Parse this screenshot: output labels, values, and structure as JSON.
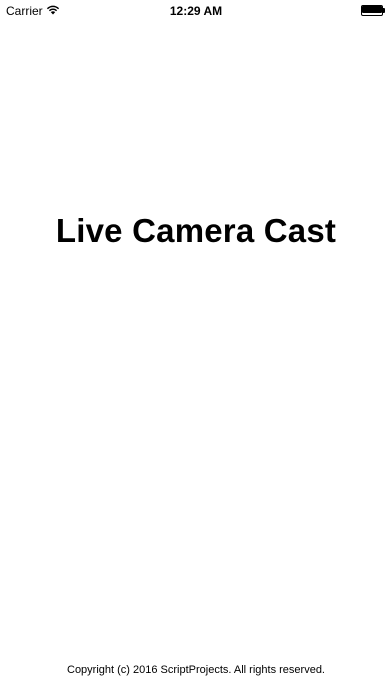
{
  "status_bar": {
    "carrier": "Carrier",
    "wifi_icon": "wifi-icon",
    "time": "12:29 AM",
    "battery_icon": "battery-icon",
    "battery_level": 1.0
  },
  "splash": {
    "title": "Live Camera Cast",
    "copyright": "Copyright (c) 2016 ScriptProjects. All rights reserved."
  },
  "colors": {
    "background": "#ffffff",
    "text": "#000000"
  }
}
